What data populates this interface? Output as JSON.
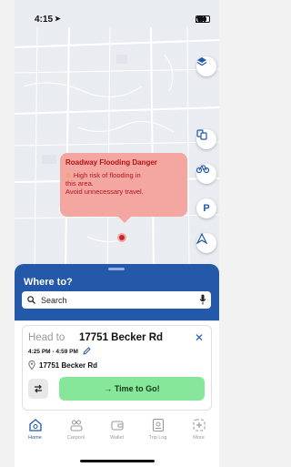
{
  "status_bar": {
    "time": "4:15"
  },
  "map": {
    "alert": {
      "title": "Roadway Flooding Danger",
      "line1": "High risk of flooding in",
      "line2": "this area.",
      "line3": "Avoid unnecessary travel."
    },
    "buttons": [
      "layers-icon",
      "transit-icon",
      "bike-icon",
      "parking-icon",
      "navigate-icon"
    ],
    "parking_label": "P"
  },
  "where_to": {
    "title": "Where to?",
    "search_placeholder": "Search"
  },
  "trip": {
    "head_to_label": "Head to",
    "destination": "17751 Becker Rd",
    "time_window": "4:25 PM - 4:59 PM",
    "address": "17751 Becker Rd",
    "go_label": "→ Time to Go!"
  },
  "tabs": [
    {
      "label": "Home",
      "icon": "home-icon"
    },
    {
      "label": "Carpool",
      "icon": "carpool-icon"
    },
    {
      "label": "Wallet",
      "icon": "wallet-icon"
    },
    {
      "label": "Trip Log",
      "icon": "trip-log-icon"
    },
    {
      "label": "More",
      "icon": "more-icon"
    }
  ],
  "colors": {
    "primary": "#2359a8",
    "alert_bg": "#f4a6a0",
    "alert_text": "#b5131a",
    "go_bg": "#86e69a"
  }
}
